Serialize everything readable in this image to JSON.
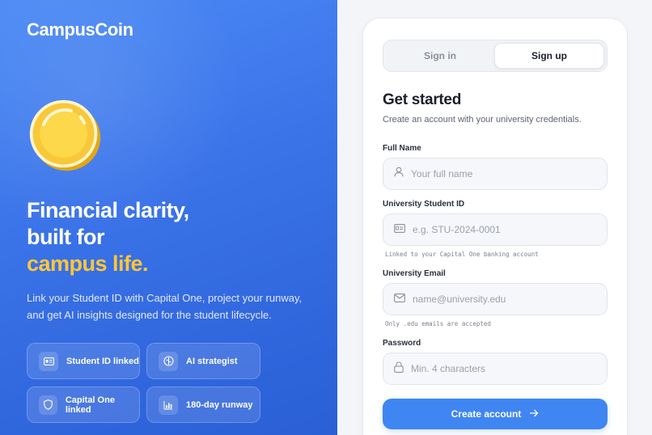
{
  "brand": {
    "name": "CampusCoin"
  },
  "hero": {
    "headline_line1": "Financial clarity,",
    "headline_line2": "built for",
    "headline_accent": "campus life.",
    "description": "Link your Student ID with Capital One, project your runway, and get AI insights designed for the student lifecycle.",
    "chips": [
      {
        "label": "Student ID linked",
        "icon": "id-card-icon"
      },
      {
        "label": "AI strategist",
        "icon": "brain-icon"
      },
      {
        "label": "Capital One linked",
        "icon": "shield-icon"
      },
      {
        "label": "180-day runway",
        "icon": "bar-chart-icon"
      }
    ]
  },
  "auth": {
    "tabs": [
      {
        "label": "Sign in",
        "active": false
      },
      {
        "label": "Sign up",
        "active": true
      }
    ],
    "title": "Get started",
    "subtitle": "Create an account with your university credentials.",
    "fields": [
      {
        "label": "Full Name",
        "placeholder": "Your full name",
        "value": "",
        "icon": "user-icon"
      },
      {
        "label": "University Student ID",
        "placeholder": "e.g. STU-2024-0001",
        "value": "",
        "icon": "id-card-icon",
        "hint": "Linked to your Capital One banking account"
      },
      {
        "label": "University Email",
        "placeholder": "name@university.edu",
        "value": "",
        "icon": "mail-icon",
        "hint": "Only .edu emails are accepted"
      },
      {
        "label": "Password",
        "placeholder": "Min. 4 characters",
        "value": "",
        "icon": "lock-icon"
      }
    ],
    "submit_label": "Create account"
  },
  "colors": {
    "accent": "#3f86f3",
    "hero_accent": "#ffc63a"
  }
}
